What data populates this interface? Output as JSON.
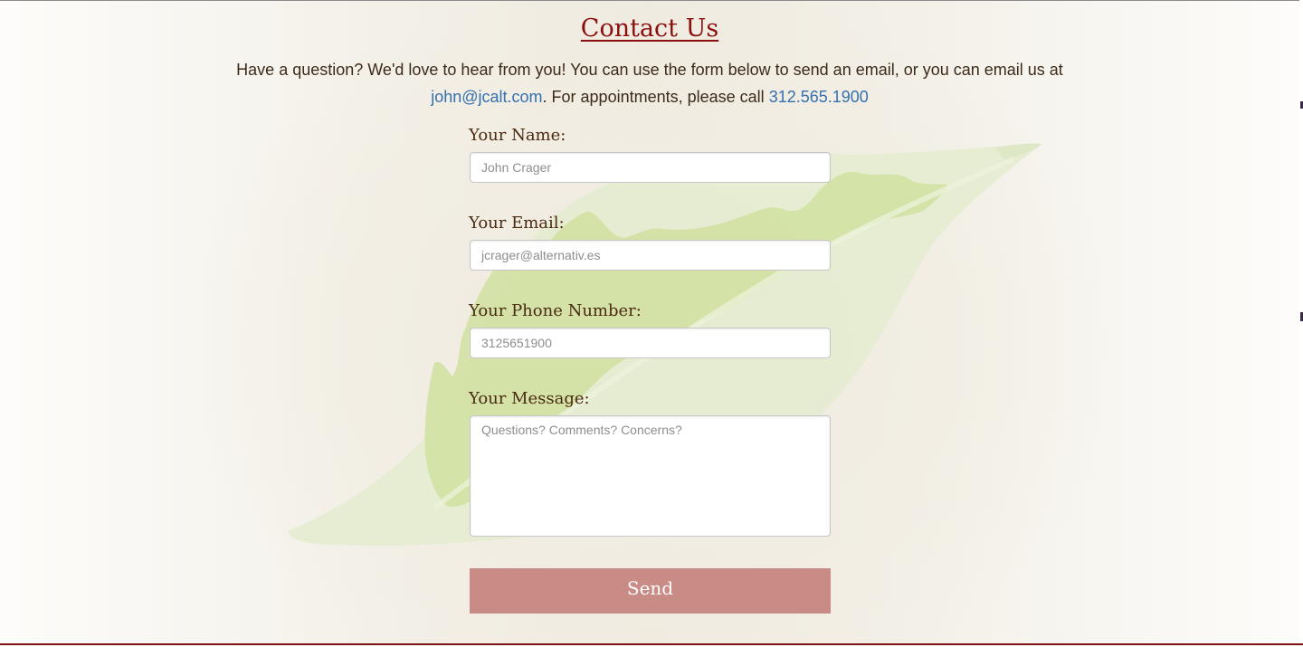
{
  "header": {
    "title": "Contact Us"
  },
  "intro": {
    "text_before_email": "Have a question? We'd love to hear from you! You can use the form below to send an email, or you can email us at",
    "email": "john@jcalt.com",
    "text_before_phone": ". For appointments, please call",
    "phone": "312.565.1900"
  },
  "form": {
    "name": {
      "label": "Your Name:",
      "placeholder": "John Crager",
      "value": ""
    },
    "email": {
      "label": "Your Email:",
      "placeholder": "jcrager@alternativ.es",
      "value": ""
    },
    "phone": {
      "label": "Your Phone Number:",
      "placeholder": "3125651900",
      "value": ""
    },
    "message": {
      "label": "Your Message:",
      "placeholder": "Questions? Comments? Concerns?",
      "value": ""
    },
    "send_label": "Send"
  },
  "colors": {
    "title": "#8b0f0f",
    "link": "#3470b0",
    "label": "#4a2a10",
    "send_button": "#c98b85",
    "leaf_light": "#e3ebcd",
    "leaf_dark": "#d2e2a6",
    "bottom_rule": "#7a1414"
  },
  "icons": {
    "background": "leaf-icon"
  }
}
